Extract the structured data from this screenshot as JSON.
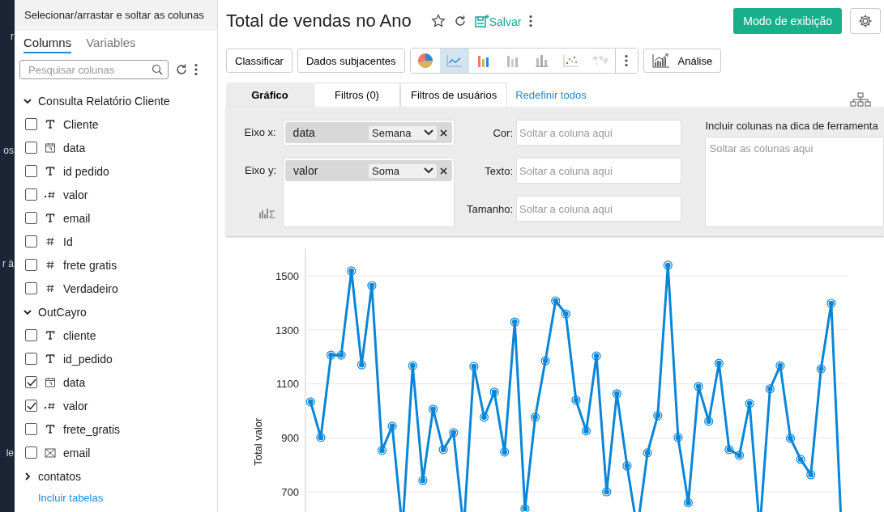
{
  "nav_fragments": [
    "r",
    "os",
    "r à",
    "le"
  ],
  "sidebar": {
    "header": "Selecionar/arrastar e soltar as colunas",
    "tabs": [
      {
        "label": "Columns",
        "selected": true
      },
      {
        "label": "Variables",
        "selected": false
      }
    ],
    "search": {
      "placeholder": "Pesquisar colunas"
    },
    "groups": [
      {
        "name": "Consulta Relatório Cliente",
        "expanded": true,
        "columns": [
          {
            "name": "Cliente",
            "kind": "text",
            "checked": false
          },
          {
            "name": "data",
            "kind": "date",
            "checked": false
          },
          {
            "name": "id pedido",
            "kind": "text",
            "checked": false
          },
          {
            "name": "valor",
            "kind": "decimal",
            "checked": false
          },
          {
            "name": "email",
            "kind": "text",
            "checked": false
          },
          {
            "name": "Id",
            "kind": "number",
            "checked": false
          },
          {
            "name": "frete gratis",
            "kind": "number",
            "checked": false
          },
          {
            "name": "Verdadeiro",
            "kind": "number",
            "checked": false
          }
        ]
      },
      {
        "name": "OutCayro",
        "expanded": true,
        "columns": [
          {
            "name": "cliente",
            "kind": "text",
            "checked": false
          },
          {
            "name": "id_pedido",
            "kind": "text",
            "checked": false
          },
          {
            "name": "data",
            "kind": "date",
            "checked": true
          },
          {
            "name": "valor",
            "kind": "decimal",
            "checked": true
          },
          {
            "name": "frete_gratis",
            "kind": "text",
            "checked": false
          },
          {
            "name": "email",
            "kind": "email",
            "checked": false
          }
        ]
      },
      {
        "name": "contatos",
        "expanded": false
      }
    ],
    "link": "Incluir tabelas"
  },
  "title": "Total de vendas no Ano",
  "save_label": "Salvar",
  "view_mode_button": "Modo de exibição",
  "toolbar": {
    "buttons": [
      "Classificar",
      "Dados subjacentes"
    ],
    "chart_types": [
      {
        "kind": "pie",
        "selected": false
      },
      {
        "kind": "line",
        "selected": true
      },
      {
        "kind": "bar",
        "selected": false
      },
      {
        "kind": "stacked-bar",
        "selected": false
      },
      {
        "kind": "grouped-bar",
        "selected": false
      },
      {
        "kind": "scatter",
        "selected": false
      },
      {
        "kind": "map",
        "selected": false
      }
    ],
    "analysis_button": "Análise"
  },
  "config_tabs": [
    {
      "label": "Gráfico",
      "selected": true
    },
    {
      "label": "Filtros  (0)",
      "selected": false
    },
    {
      "label": "Filtros de usuários",
      "selected": false
    }
  ],
  "reset_link": "Redefinir todos",
  "x_axis": {
    "label": "Eixo x:",
    "column": "data",
    "function": "Semana"
  },
  "y_axis": {
    "label": "Eixo y:",
    "column": "valor",
    "function": "Soma"
  },
  "drop_fields": [
    {
      "label": "Cor:",
      "placeholder": "Soltar a coluna aqui"
    },
    {
      "label": "Texto:",
      "placeholder": "Soltar a coluna aqui"
    },
    {
      "label": "Tamanho:",
      "placeholder": "Soltar a coluna aqui"
    }
  ],
  "tooltip_box": {
    "label": "Incluir colunas na dica de ferramenta",
    "placeholder": "Soltar as colunas aqui"
  },
  "chart_data": {
    "type": "line",
    "ylabel": "Total valor",
    "ylim": [
      540,
      1600
    ],
    "yticks": [
      700,
      900,
      1100,
      1300,
      1500
    ],
    "grid": true,
    "series": [
      {
        "color": "#0a86d8",
        "marker": "circle",
        "values": [
          1033,
          901,
          1206,
          1206,
          1518,
          1170,
          1464,
          853,
          943,
          560,
          1167,
          742,
          1006,
          856,
          919,
          560,
          1164,
          976,
          1069,
          847,
          1329,
          637,
          976,
          1185,
          1407,
          1359,
          1039,
          925,
          1203,
          700,
          1063,
          796,
          560,
          844,
          982,
          1539,
          901,
          659,
          1090,
          961,
          1176,
          856,
          835,
          1027,
          560,
          1081,
          1167,
          898,
          820,
          763,
          1155,
          1398,
          560
        ]
      }
    ]
  }
}
